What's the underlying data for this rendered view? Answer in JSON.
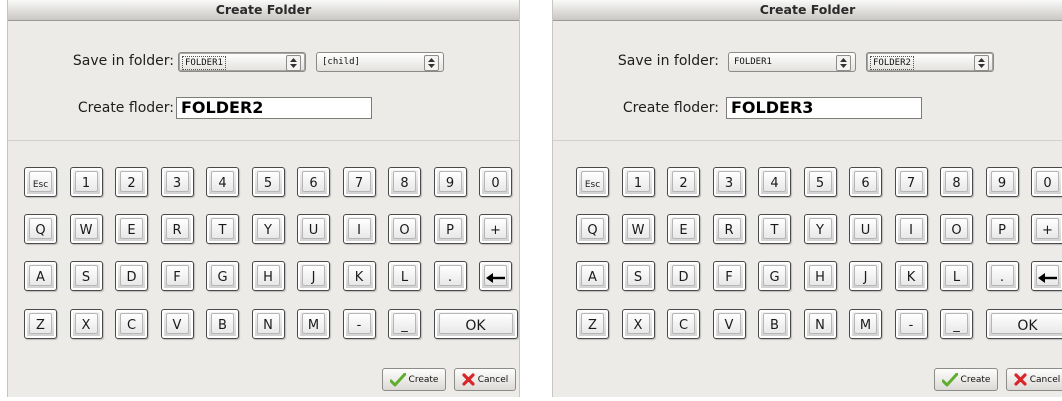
{
  "dialogs": [
    {
      "title": "Create Folder",
      "save_in_label": "Save in folder:",
      "folder_combo_1": "FOLDER1",
      "folder_combo_2": "[child]",
      "create_label": "Create floder:",
      "folder_name_value": "FOLDER2",
      "create_button": "Create",
      "cancel_button": "Cancel"
    },
    {
      "title": "Create Folder",
      "save_in_label": "Save in folder:",
      "folder_combo_1": "FOLDER1",
      "folder_combo_2": "FOLDER2",
      "create_label": "Create floder:",
      "folder_name_value": "FOLDER3",
      "create_button": "Create",
      "cancel_button": "Cancel"
    }
  ],
  "keyboard": {
    "rows": [
      [
        "Esc",
        "1",
        "2",
        "3",
        "4",
        "5",
        "6",
        "7",
        "8",
        "9",
        "0"
      ],
      [
        "Q",
        "W",
        "E",
        "R",
        "T",
        "Y",
        "U",
        "I",
        "O",
        "P",
        "+"
      ],
      [
        "A",
        "S",
        "D",
        "F",
        "G",
        "H",
        "J",
        "K",
        "L",
        ".",
        "←"
      ],
      [
        "Z",
        "X",
        "C",
        "V",
        "B",
        "N",
        "M",
        "-",
        "_",
        "OK"
      ]
    ]
  },
  "icons": {
    "create": "checkmark-icon",
    "cancel": "red-x-icon",
    "combo_arrows": "updown-arrows-icon",
    "backspace": "left-arrow-icon"
  },
  "colors": {
    "dialog_bg": "#edebe7",
    "check_green": "#5fae2f",
    "cancel_red": "#d8262b"
  }
}
